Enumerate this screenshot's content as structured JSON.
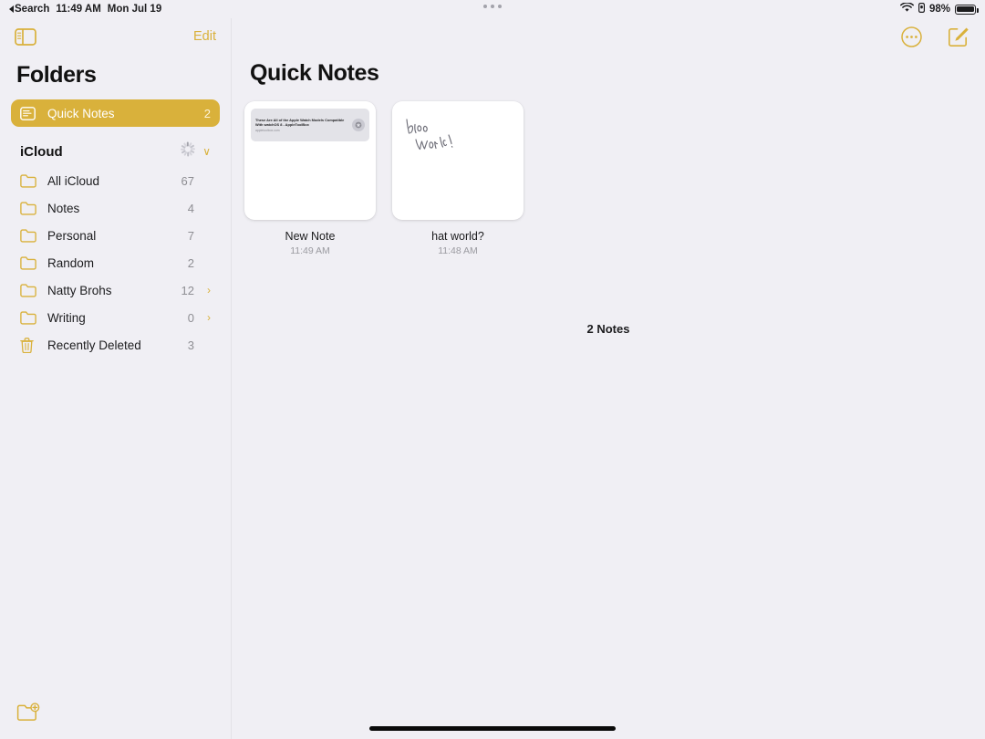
{
  "status_bar": {
    "back_label": "Search",
    "time": "11:49 AM",
    "date": "Mon Jul 19",
    "battery_percent": "98%",
    "wifi_icon": "wifi-icon",
    "lock_icon": "portrait-lock-icon",
    "battery_icon": "battery-icon"
  },
  "sidebar": {
    "toggle_icon": "sidebar-toggle-icon",
    "edit_label": "Edit",
    "title": "Folders",
    "quick_notes": {
      "label": "Quick Notes",
      "count": "2",
      "icon": "quick-note-icon"
    },
    "account": {
      "label": "iCloud",
      "spinner_icon": "activity-spinner-icon",
      "chevron": "∨"
    },
    "items": [
      {
        "label": "All iCloud",
        "count": "67",
        "icon": "folder-icon",
        "chevron": ""
      },
      {
        "label": "Notes",
        "count": "4",
        "icon": "folder-icon",
        "chevron": ""
      },
      {
        "label": "Personal",
        "count": "7",
        "icon": "folder-icon",
        "chevron": ""
      },
      {
        "label": "Random",
        "count": "2",
        "icon": "folder-icon",
        "chevron": ""
      },
      {
        "label": "Natty Brohs",
        "count": "12",
        "icon": "folder-icon",
        "chevron": "›"
      },
      {
        "label": "Writing",
        "count": "0",
        "icon": "folder-icon",
        "chevron": "›"
      },
      {
        "label": "Recently Deleted",
        "count": "3",
        "icon": "trash-icon",
        "chevron": ""
      }
    ],
    "new_folder_icon": "new-folder-icon"
  },
  "main": {
    "title": "Quick Notes",
    "more_icon": "more-circle-icon",
    "compose_icon": "compose-note-icon",
    "notes": [
      {
        "title": "New Note",
        "time": "11:49 AM",
        "preview_type": "link-card",
        "link_title": "These Are All of the Apple Watch Models Compatible With watchOS 8 - AppleToolBox",
        "link_url": "appletoolbox.com"
      },
      {
        "title": "hat world?",
        "time": "11:48 AM",
        "preview_type": "handwriting",
        "handwriting_text": "hello World !"
      }
    ],
    "count_label": "2 Notes"
  },
  "colors": {
    "accent": "#d9b13b",
    "background": "#f0eff4",
    "text": "#1c1c1e",
    "secondary_text": "#8e8e93"
  }
}
